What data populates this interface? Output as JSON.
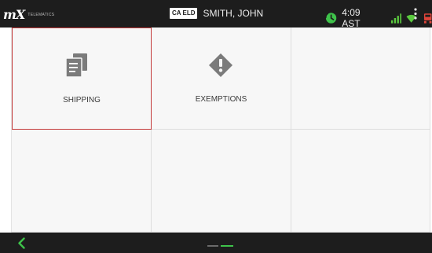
{
  "header": {
    "brand_logo": "mX",
    "brand_sub": "TELEMATICS",
    "eld_badge": "CA ELD",
    "driver_name": "SMITH, JOHN",
    "time": "4:09 AST",
    "icons": [
      "clock-status-icon",
      "signal-bars-icon",
      "wifi-icon",
      "truck-icon",
      "overflow-menu-icon"
    ]
  },
  "tiles": [
    {
      "label": "SHIPPING",
      "icon": "documents-icon",
      "selected": true
    },
    {
      "label": "EXEMPTIONS",
      "icon": "warning-diamond-icon",
      "selected": false
    },
    {
      "label": "",
      "icon": "",
      "selected": false
    },
    {
      "label": "",
      "icon": "",
      "selected": false
    },
    {
      "label": "",
      "icon": "",
      "selected": false
    },
    {
      "label": "",
      "icon": "",
      "selected": false
    }
  ],
  "footer": {
    "back_icon": "back-chevron-icon",
    "page_indicator": {
      "pages": 2,
      "current": 2
    }
  },
  "colors": {
    "bar_background": "#1d1d1d",
    "tile_background": "#f7f7f7",
    "selected_border": "#c33a3a",
    "accent_green": "#3ec24a",
    "signal_green": "#5bc93f",
    "truck_red": "#e0443a",
    "icon_gray": "#7b7b7b"
  }
}
